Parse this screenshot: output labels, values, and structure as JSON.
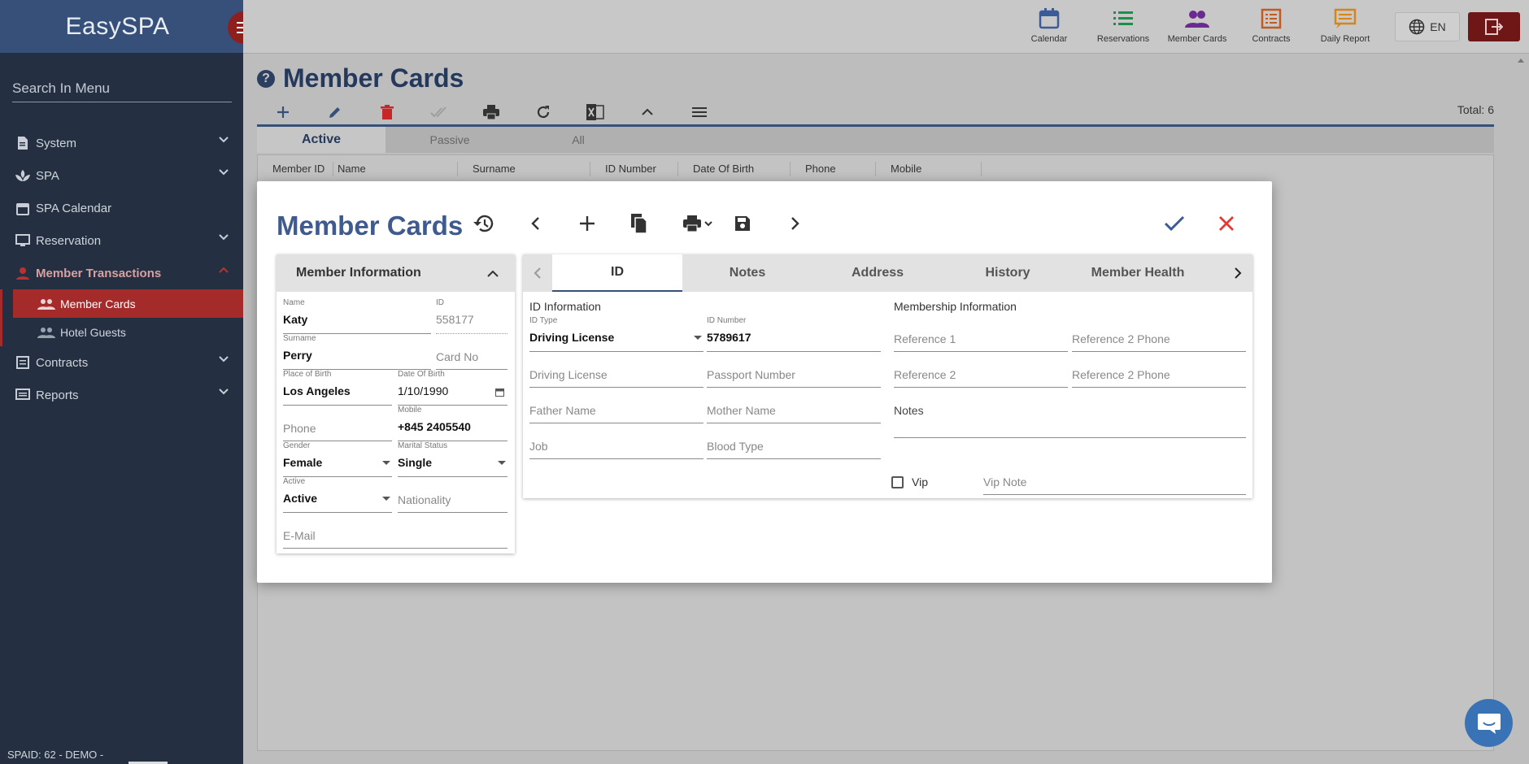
{
  "app": {
    "logo": "EasySPA",
    "spaid": "SPAID: 62 - DEMO -"
  },
  "sidebar": {
    "search_placeholder": "Search In Menu",
    "items": [
      {
        "label": "System",
        "icon": "document-icon"
      },
      {
        "label": "SPA",
        "icon": "spa-icon"
      },
      {
        "label": "SPA Calendar",
        "icon": "calendar-icon"
      },
      {
        "label": "Reservation",
        "icon": "monitor-icon"
      },
      {
        "label": "Member Transactions",
        "icon": "person-icon"
      },
      {
        "label": "Contracts",
        "icon": "list-icon"
      },
      {
        "label": "Reports",
        "icon": "report-icon"
      }
    ],
    "sub_items": [
      {
        "label": "Member Cards",
        "icon": "people-icon"
      },
      {
        "label": "Hotel Guests",
        "icon": "people-icon"
      }
    ]
  },
  "topnav": {
    "items": [
      {
        "label": "Calendar",
        "icon": "calendar-icon",
        "color": "#3a5a99"
      },
      {
        "label": "Reservations",
        "icon": "list-icon",
        "color": "#1d8f4d"
      },
      {
        "label": "Member Cards",
        "icon": "people-icon",
        "color": "#6b2a8f"
      },
      {
        "label": "Contracts",
        "icon": "contract-icon",
        "color": "#c45b1e"
      },
      {
        "label": "Daily Report",
        "icon": "report-icon",
        "color": "#d4861a"
      }
    ],
    "language": "EN"
  },
  "page": {
    "title": "Member Cards",
    "total": "Total: 6",
    "status_tabs": [
      "Active",
      "Passive",
      "All"
    ],
    "columns": [
      "Member ID",
      "Name",
      "Surname",
      "ID Number",
      "Date Of Birth",
      "Phone",
      "Mobile"
    ]
  },
  "modal": {
    "title": "Member Cards",
    "left_panel": {
      "title": "Member Information",
      "name": {
        "label": "Name",
        "value": "Katy"
      },
      "id": {
        "label": "ID",
        "value": "558177"
      },
      "surname": {
        "label": "Surname",
        "value": "Perry"
      },
      "card_no": {
        "placeholder": "Card No"
      },
      "place_of_birth": {
        "label": "Place of Birth",
        "value": "Los Angeles"
      },
      "date_of_birth": {
        "label": "Date Of Birth",
        "value": "1/10/1990"
      },
      "phone": {
        "placeholder": "Phone"
      },
      "mobile": {
        "label": "Mobile",
        "value": "+845 2405540"
      },
      "gender": {
        "label": "Gender",
        "value": "Female"
      },
      "marital_status": {
        "label": "Marital Status",
        "value": "Single"
      },
      "active": {
        "label": "Active",
        "value": "Active"
      },
      "nationality": {
        "placeholder": "Nationality"
      },
      "email": {
        "placeholder": "E-Mail"
      }
    },
    "tabs": [
      "ID",
      "Notes",
      "Address",
      "History",
      "Member Health"
    ],
    "id_tab": {
      "id_information_title": "ID Information",
      "membership_information_title": "Membership Information",
      "id_type": {
        "label": "ID Type",
        "value": "Driving License"
      },
      "id_number": {
        "label": "ID Number",
        "value": "5789617"
      },
      "driving_license": {
        "placeholder": "Driving License"
      },
      "passport_number": {
        "placeholder": "Passport Number"
      },
      "father_name": {
        "placeholder": "Father Name"
      },
      "mother_name": {
        "placeholder": "Mother Name"
      },
      "job": {
        "placeholder": "Job"
      },
      "blood_type": {
        "placeholder": "Blood Type"
      },
      "reference1": {
        "placeholder": "Reference 1"
      },
      "reference1_phone": {
        "placeholder": "Reference 2 Phone"
      },
      "reference2": {
        "placeholder": "Reference 2"
      },
      "reference2_phone": {
        "placeholder": "Reference 2 Phone"
      },
      "notes": {
        "placeholder": "Notes"
      },
      "vip_label": "Vip",
      "vip_note": {
        "placeholder": "Vip Note"
      }
    }
  }
}
